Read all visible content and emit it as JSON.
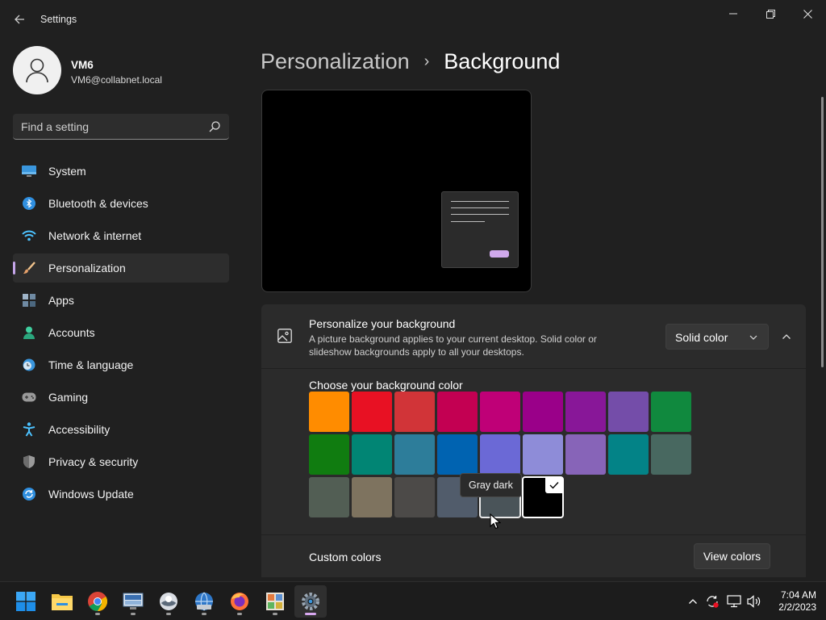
{
  "window": {
    "title": "Settings",
    "controls": {
      "minimize": "minimize-icon",
      "maximize": "restore-icon",
      "close": "close-icon"
    }
  },
  "user": {
    "name": "VM6",
    "email": "VM6@collabnet.local"
  },
  "search": {
    "placeholder": "Find a setting"
  },
  "sidebar": {
    "items": [
      {
        "label": "System",
        "icon": "system-icon",
        "active": false
      },
      {
        "label": "Bluetooth & devices",
        "icon": "bluetooth-icon",
        "active": false
      },
      {
        "label": "Network & internet",
        "icon": "wifi-icon",
        "active": false
      },
      {
        "label": "Personalization",
        "icon": "brush-icon",
        "active": true
      },
      {
        "label": "Apps",
        "icon": "apps-icon",
        "active": false
      },
      {
        "label": "Accounts",
        "icon": "accounts-icon",
        "active": false
      },
      {
        "label": "Time & language",
        "icon": "clock-globe-icon",
        "active": false
      },
      {
        "label": "Gaming",
        "icon": "gamepad-icon",
        "active": false
      },
      {
        "label": "Accessibility",
        "icon": "accessibility-icon",
        "active": false
      },
      {
        "label": "Privacy & security",
        "icon": "shield-icon",
        "active": false
      },
      {
        "label": "Windows Update",
        "icon": "update-icon",
        "active": false
      }
    ]
  },
  "breadcrumb": {
    "parent": "Personalization",
    "separator": "›",
    "current": "Background"
  },
  "personalize": {
    "title": "Personalize your background",
    "description": "A picture background applies to your current desktop. Solid color or slideshow backgrounds apply to all your desktops.",
    "type_value": "Solid color"
  },
  "colors": {
    "label": "Choose your background color",
    "rows": [
      [
        "#FF8C00",
        "#E81123",
        "#D13438",
        "#C30052",
        "#BF0077",
        "#9A0089",
        "#881798",
        "#744DA9",
        "#10893E"
      ],
      [
        "#107C10",
        "#018574",
        "#2D7D9A",
        "#0063B1",
        "#6B69D6",
        "#8E8CD8",
        "#8764B8",
        "#038387",
        "#486860"
      ],
      [
        "#525E54",
        "#7E735F",
        "#4C4A48",
        "#515C6B",
        "#4A5459",
        "#000000"
      ]
    ],
    "selected": "#000000",
    "hovered": "#4A5459",
    "tooltip": "Gray dark"
  },
  "custom_colors": {
    "label": "Custom colors",
    "button": "View colors"
  },
  "taskbar": {
    "apps": [
      "start-icon",
      "chrome-icon",
      "file-explorer-icon",
      "remote-desktop-icon",
      "app-icon",
      "network-globe-icon",
      "firefox-icon",
      "control-panel-icon",
      "settings-gear-icon"
    ],
    "tray": [
      "chevron-up-icon",
      "sync-icon",
      "network-icon",
      "volume-icon"
    ],
    "time": "7:04 AM",
    "date": "2/2/2023"
  },
  "accent": "#C4A5E9"
}
